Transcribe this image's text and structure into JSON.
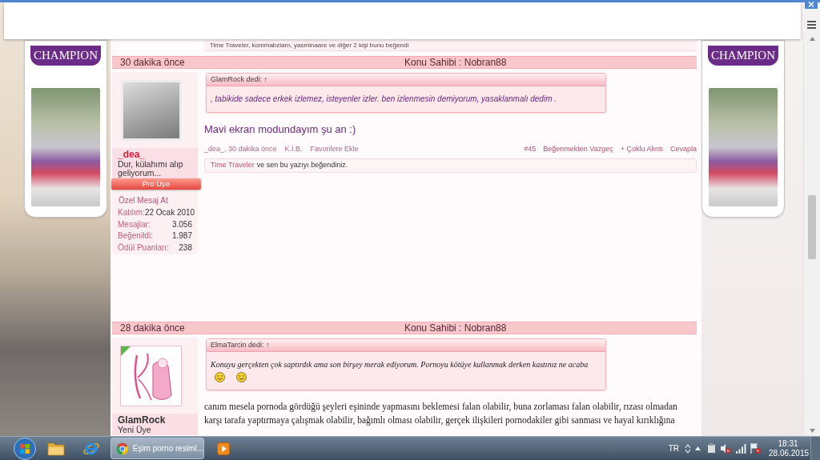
{
  "ads": [
    {
      "logo": "CHAMPION"
    },
    {
      "logo": "CHAMPION"
    }
  ],
  "previous_post": {
    "likes_text": "Time Traveler, kommabzlarn, yasminaare ve diğer 2 kişi bunu beğendi"
  },
  "posts": [
    {
      "time": "30 dakika önce",
      "owner": "Konu Sahibi : Nobran88",
      "user": {
        "avatar": {
          "kind": "photo"
        },
        "online": false,
        "name": "_dea_",
        "color": "#d0203c",
        "title": "Dur, külahımı alıp geliyorum...",
        "rank": "Pro Üye",
        "message_link": "Özel Mesaj At",
        "stats": [
          {
            "label": "Katılım:",
            "value": "22 Ocak 2010"
          },
          {
            "label": "Mesajlar:",
            "value": "3.056"
          },
          {
            "label": "Beğenildi:",
            "value": "1.987"
          },
          {
            "label": "Ödül Puanları:",
            "value": "238"
          }
        ]
      },
      "quote": {
        "kind": "sans",
        "header": "GlamRock dedi: ↑",
        "parts": [
          {
            "kind": "text",
            "text": ", tabikide sadece erkek izlemez, isteyenler izler. ben izlenmesin demiyorum, yasaklanmalı dedim ."
          }
        ]
      },
      "body": {
        "kind": "sans",
        "text": "Mavi ekran modundayım şu an :)"
      },
      "footer": {
        "left": [
          "_dea_, 30 dakika önce",
          "K.İ.B.",
          "Favorilere Ekle"
        ],
        "right": [
          "#45",
          "Beğenmekten Vazgeç",
          "+ Çoklu Alıntı",
          "Cevapla"
        ]
      },
      "likes": {
        "user": "Time Traveler",
        "text": "ve sen bu yazıyı beğendiniz."
      }
    },
    {
      "time": "28 dakika önce",
      "owner": "Konu Sahibi : Nobran88",
      "user": {
        "avatar": {
          "kind": "logo"
        },
        "online": true,
        "name": "GlamRock",
        "color": "#333333",
        "title": "Yeni Üye"
      },
      "quote": {
        "kind": "serif",
        "header": "ElmaTarcin dedi: ↑",
        "parts": [
          {
            "kind": "text",
            "text": "Konuyu gerçekten çok saptırdık ama son birşey merak ediyorum. Pornoyu kötüye kullanmak derken kastınız ne acaba"
          },
          {
            "kind": "smiley"
          },
          {
            "kind": "smiley"
          }
        ]
      },
      "body": {
        "kind": "serif",
        "text": "canım mesela pornoda gördüğü şeyleri eşininde yapmasını beklemesi falan olabilir, buna zorlaması falan olabilir, rızası olmadan karşı tarafa yaptırmaya çalışmak olabilir, bağımlı olması olabilir, gerçek ilişkileri pornodakiler gibi sanması ve hayal kırıklığına"
      }
    }
  ],
  "taskbar": {
    "window_title": "Eşim porno resiml...",
    "language": "TR",
    "time": "18:31",
    "date": "28.06.2015"
  }
}
